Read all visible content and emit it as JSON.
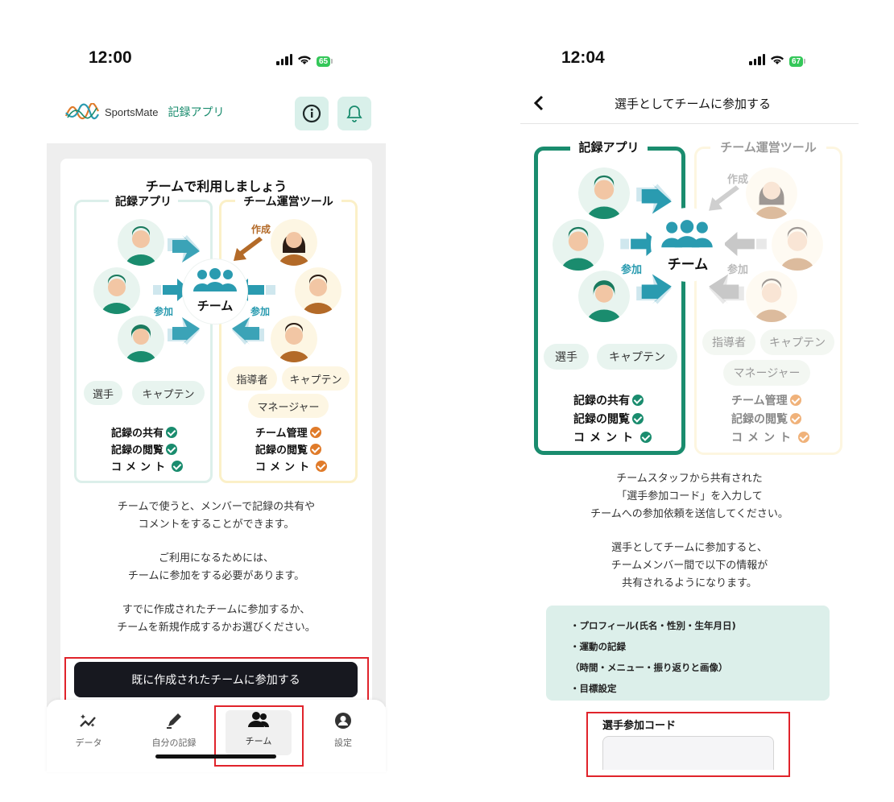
{
  "left": {
    "status_time": "12:00",
    "battery": "65",
    "logo_text": "SportsMate",
    "app_name": "記録アプリ",
    "card_title": "チームで利用しましょう",
    "panel_left_title": "記録アプリ",
    "panel_right_title": "チーム運営ツール",
    "label_create": "作成",
    "label_join_left": "参加",
    "label_join_right": "参加",
    "team_label": "チーム",
    "roles_left": [
      "選手",
      "キャプテン"
    ],
    "roles_right": [
      "指導者",
      "キャプテン",
      "マネージャー"
    ],
    "features_left": [
      "記録の共有",
      "記録の閲覧",
      "コメント"
    ],
    "features_right": [
      "チーム管理",
      "記録の閲覧",
      "コメント"
    ],
    "desc1": [
      "チームで使うと、メンバーで記録の共有や",
      "コメントをすることができます。"
    ],
    "desc2": [
      "ご利用になるためには、",
      "チームに参加をする必要があります。"
    ],
    "desc3": [
      "すでに作成されたチームに参加するか、",
      "チームを新規作成するかお選びください。"
    ],
    "join_button": "既に作成されたチームに参加する",
    "tabs": [
      "データ",
      "自分の記録",
      "チーム",
      "設定"
    ]
  },
  "right": {
    "status_time": "12:04",
    "battery": "67",
    "header_title": "選手としてチームに参加する",
    "panel_left_title": "記録アプリ",
    "panel_right_title": "チーム運営ツール",
    "label_create": "作成",
    "label_join_left": "参加",
    "label_join_right": "参加",
    "team_label": "チーム",
    "roles_left": [
      "選手",
      "キャプテン"
    ],
    "roles_right": [
      "指導者",
      "キャプテン",
      "マネージャー"
    ],
    "features_left": [
      "記録の共有",
      "記録の閲覧",
      "コメント"
    ],
    "features_right": [
      "チーム管理",
      "記録の閲覧",
      "コメント"
    ],
    "desc1": [
      "チームスタッフから共有された",
      "「選手参加コード」を入力して",
      "チームへの参加依頼を送信してください。"
    ],
    "desc2": [
      "選手としてチームに参加すると、",
      "チームメンバー間で以下の情報が",
      "共有されるようになります。"
    ],
    "info": [
      "・プロフィール(氏名・性別・生年月日)",
      "・運動の記録",
      "（時間・メニュー・振り返りと画像）",
      "・目標設定"
    ],
    "code_label": "選手参加コード",
    "code_value": ""
  },
  "colors": {
    "green": "#1a8c6e",
    "teal": "#2a9bb0",
    "orange": "#e07b2a",
    "dark_button": "#17181f",
    "highlight": "#e0232b"
  }
}
